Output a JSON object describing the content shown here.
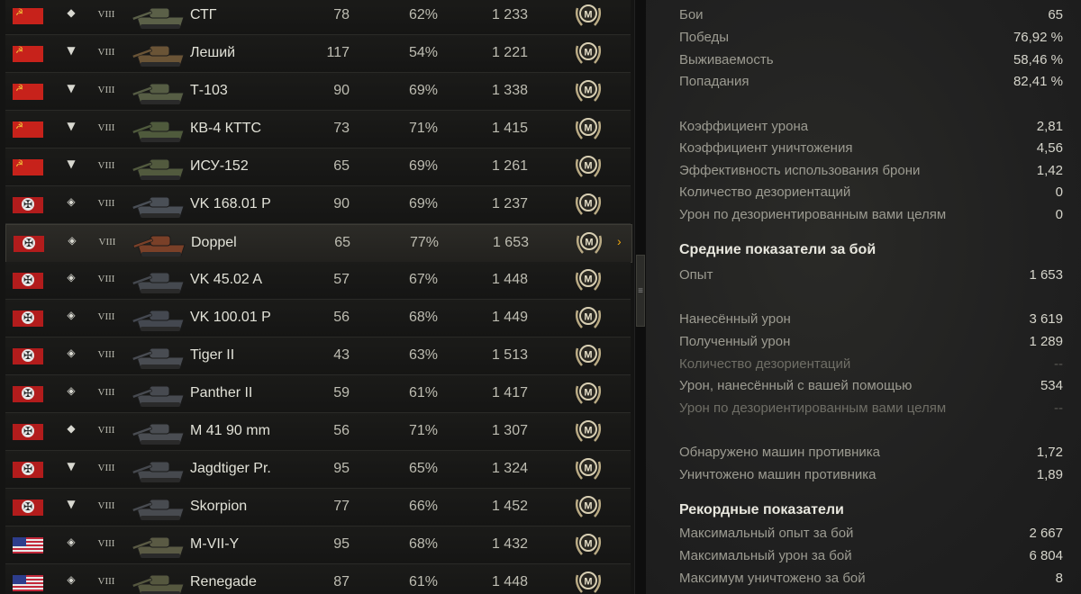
{
  "vehicles": [
    {
      "nation": "ussr",
      "cls": "◆",
      "tier": "VIII",
      "name": "СТГ",
      "battles": "78",
      "winrate": "62%",
      "exp": "1 233",
      "mastery": "M",
      "color": "#5b6048"
    },
    {
      "nation": "ussr",
      "cls": "▼",
      "tier": "VIII",
      "name": "Леший",
      "battles": "117",
      "winrate": "54%",
      "exp": "1 221",
      "mastery": "M",
      "color": "#6a5436"
    },
    {
      "nation": "ussr",
      "cls": "▼",
      "tier": "VIII",
      "name": "Т-103",
      "battles": "90",
      "winrate": "69%",
      "exp": "1 338",
      "mastery": "M",
      "color": "#565d44"
    },
    {
      "nation": "ussr",
      "cls": "▼",
      "tier": "VIII",
      "name": "КВ-4 КТТС",
      "battles": "73",
      "winrate": "71%",
      "exp": "1 415",
      "mastery": "M",
      "color": "#4f5a3c"
    },
    {
      "nation": "ussr",
      "cls": "▼",
      "tier": "VIII",
      "name": "ИСУ-152",
      "battles": "65",
      "winrate": "69%",
      "exp": "1 261",
      "mastery": "M",
      "color": "#525a3e"
    },
    {
      "nation": "ger",
      "cls": "◈",
      "tier": "VIII",
      "name": "VK 168.01 P",
      "battles": "90",
      "winrate": "69%",
      "exp": "1 237",
      "mastery": "M",
      "color": "#4a4f56"
    },
    {
      "nation": "ger",
      "cls": "◈",
      "tier": "VIII",
      "name": "Doppel",
      "battles": "65",
      "winrate": "77%",
      "exp": "1 653",
      "mastery": "M",
      "color": "#7a4028"
    },
    {
      "nation": "ger",
      "cls": "◈",
      "tier": "VIII",
      "name": "VK 45.02 A",
      "battles": "57",
      "winrate": "67%",
      "exp": "1 448",
      "mastery": "M",
      "color": "#45494f"
    },
    {
      "nation": "ger",
      "cls": "◈",
      "tier": "VIII",
      "name": "VK 100.01 P",
      "battles": "56",
      "winrate": "68%",
      "exp": "1 449",
      "mastery": "M",
      "color": "#444850"
    },
    {
      "nation": "ger",
      "cls": "◈",
      "tier": "VIII",
      "name": "Tiger II",
      "battles": "43",
      "winrate": "63%",
      "exp": "1 513",
      "mastery": "M",
      "color": "#494c52"
    },
    {
      "nation": "ger",
      "cls": "◈",
      "tier": "VIII",
      "name": "Panther II",
      "battles": "59",
      "winrate": "61%",
      "exp": "1 417",
      "mastery": "M",
      "color": "#474a50"
    },
    {
      "nation": "ger",
      "cls": "◆",
      "tier": "VIII",
      "name": "M 41 90 mm",
      "battles": "56",
      "winrate": "71%",
      "exp": "1 307",
      "mastery": "M",
      "color": "#4a4d52"
    },
    {
      "nation": "ger",
      "cls": "▼",
      "tier": "VIII",
      "name": "Jagdtiger Pr.",
      "battles": "95",
      "winrate": "65%",
      "exp": "1 324",
      "mastery": "M",
      "color": "#46494e"
    },
    {
      "nation": "ger",
      "cls": "▼",
      "tier": "VIII",
      "name": "Skorpion",
      "battles": "77",
      "winrate": "66%",
      "exp": "1 452",
      "mastery": "M",
      "color": "#484b50"
    },
    {
      "nation": "usa",
      "cls": "◈",
      "tier": "VIII",
      "name": "M-VII-Y",
      "battles": "95",
      "winrate": "68%",
      "exp": "1 432",
      "mastery": "M",
      "color": "#5a5a44"
    },
    {
      "nation": "usa",
      "cls": "◈",
      "tier": "VIII",
      "name": "Renegade",
      "battles": "87",
      "winrate": "61%",
      "exp": "1 448",
      "mastery": "M",
      "color": "#55573f"
    }
  ],
  "selected_index": 6,
  "scroll_thumb_icon": "≡",
  "detail_chevron": "›",
  "stats": {
    "battles": {
      "label": "Бои",
      "value": "65"
    },
    "victories": {
      "label": "Победы",
      "value": "76,92 %"
    },
    "survival": {
      "label": "Выживаемость",
      "value": "58,46 %"
    },
    "hits": {
      "label": "Попадания",
      "value": "82,41 %"
    },
    "damage_ratio": {
      "label": "Коэффициент урона",
      "value": "2,81"
    },
    "destroy_ratio": {
      "label": "Коэффициент уничтожения",
      "value": "4,56"
    },
    "armor_eff": {
      "label": "Эффективность использования брони",
      "value": "1,42"
    },
    "stuns": {
      "label": "Количество дезориентаций",
      "value": "0"
    },
    "stun_damage": {
      "label": "Урон по дезориентированным вами целям",
      "value": "0"
    }
  },
  "avg_title": "Средние показатели за бой",
  "avg": {
    "exp": {
      "label": "Опыт",
      "value": "1 653"
    },
    "dealt": {
      "label": "Нанесённый урон",
      "value": "3 619"
    },
    "received": {
      "label": "Полученный урон",
      "value": "1 289"
    },
    "stuns": {
      "label": "Количество дезориентаций",
      "value": "--"
    },
    "assist": {
      "label": "Урон, нанесённый с вашей помощью",
      "value": "534"
    },
    "stun_damage": {
      "label": "Урон по дезориентированным вами целям",
      "value": "--"
    },
    "spotted": {
      "label": "Обнаружено машин противника",
      "value": "1,72"
    },
    "destroyed": {
      "label": "Уничтожено машин противника",
      "value": "1,89"
    }
  },
  "records_title": "Рекордные показатели",
  "records": {
    "max_exp": {
      "label": "Максимальный опыт за бой",
      "value": "2 667"
    },
    "max_damage": {
      "label": "Максимальный урон за бой",
      "value": "6 804"
    },
    "max_kills": {
      "label": "Максимум уничтожено за бой",
      "value": "8"
    }
  }
}
